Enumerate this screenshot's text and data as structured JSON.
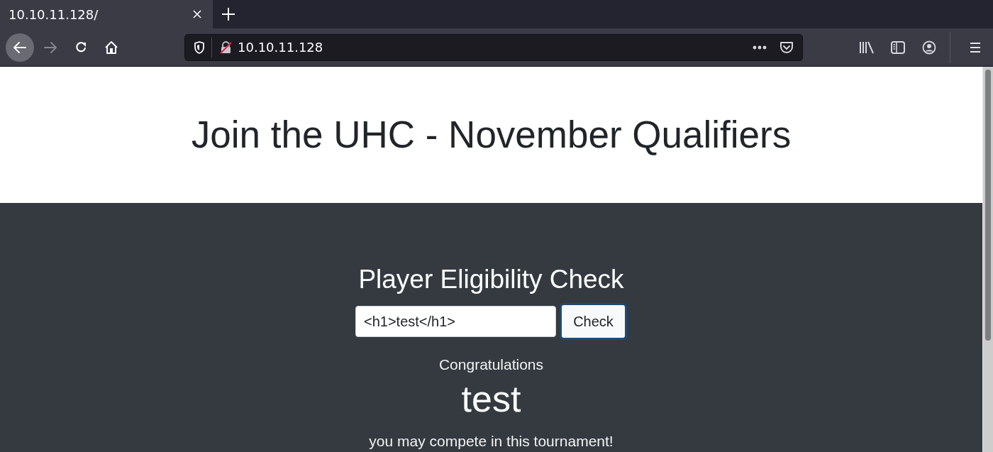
{
  "browser": {
    "tabs": [
      {
        "title": "10.10.11.128/",
        "selected": true
      }
    ],
    "nav_buttons": [
      {
        "kind": "back",
        "disabled": false,
        "hovered": true
      },
      {
        "kind": "forward",
        "disabled": true,
        "hovered": false
      },
      {
        "kind": "reload",
        "disabled": false,
        "hovered": false
      },
      {
        "kind": "home",
        "disabled": false,
        "hovered": false
      }
    ],
    "address_bar": {
      "url": "10.10.11.128"
    }
  },
  "page": {
    "heading": "Join the UHC - November Qualifiers",
    "form": {
      "title": "Player Eligibility Check",
      "input": {
        "value": "<h1>test</h1>"
      },
      "button": {
        "label": "Check",
        "focused": true
      }
    },
    "result": {
      "message": "Congratulations",
      "name": "test",
      "note": "you may compete in this tournament!"
    }
  }
}
